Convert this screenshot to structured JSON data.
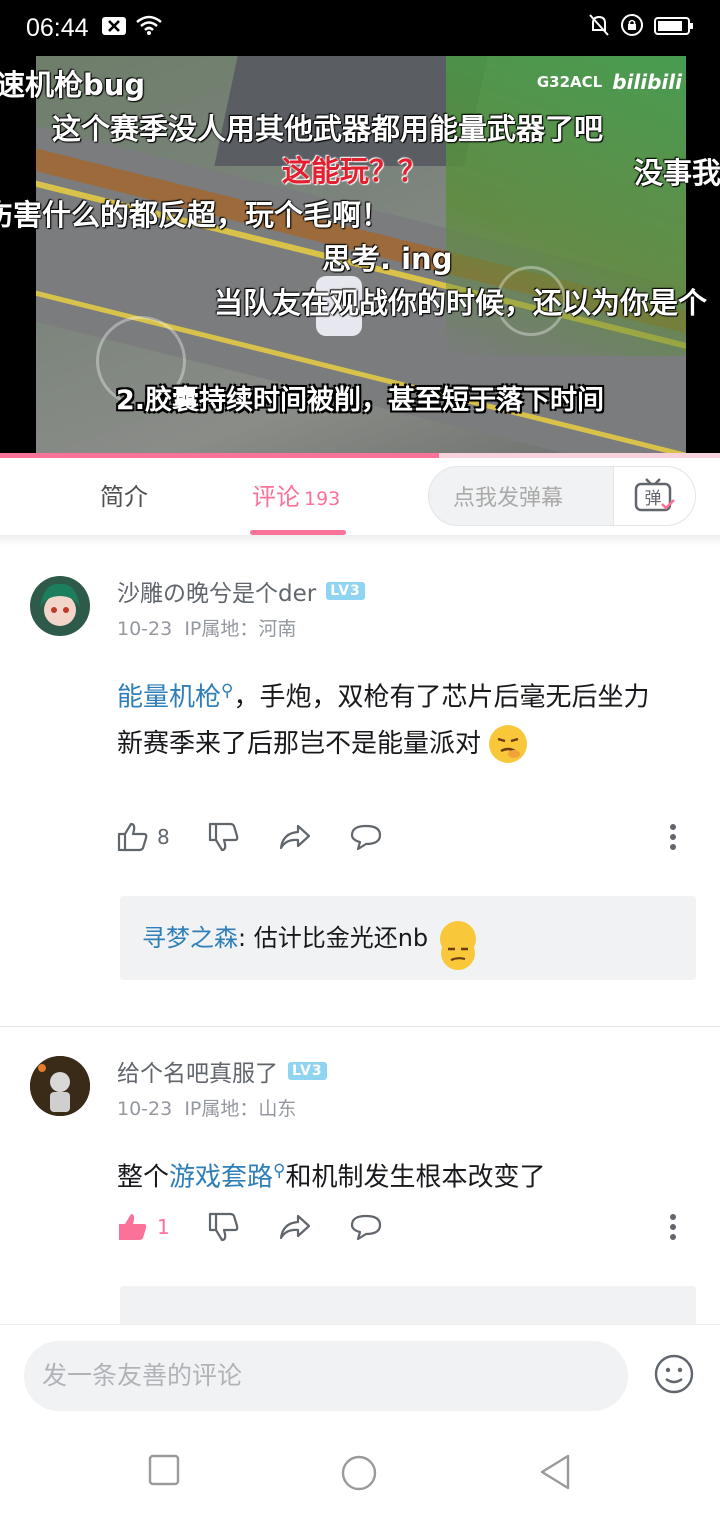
{
  "status_bar": {
    "time": "06:44"
  },
  "video": {
    "danmaku": [
      {
        "text": "速机枪bug",
        "style": "white"
      },
      {
        "text": "这个赛季没人用其他武器都用能量武器了吧",
        "style": "white"
      },
      {
        "text": "这能玩？？",
        "style": "red"
      },
      {
        "text": "没事我",
        "style": "white"
      },
      {
        "text": "伤害什么的都反超，玩个毛啊！",
        "style": "white"
      },
      {
        "text": "思考. ing",
        "style": "white"
      },
      {
        "text": "当队友在观战你的时候，还以为你是个",
        "style": "white"
      }
    ],
    "subtitle": "2.胶囊持续时间被削，甚至短于落下时间",
    "watermark_code": "G32ACL",
    "watermark_logo": "bilibili",
    "progress_percent": 61
  },
  "tabs": {
    "intro_label": "简介",
    "comments_label": "评论",
    "comments_count": "193",
    "danmu_placeholder": "点我发弹幕",
    "danmu_button": "弹"
  },
  "comments": [
    {
      "username": "沙雕の晚兮是个der",
      "level": "LV3",
      "date": "10-23",
      "ip": "IP属地：河南",
      "content_link": "能量机枪",
      "content_rest": "，手炮，双枪有了芯片后毫无后坐力",
      "content_line2": "新赛季来了后那岂不是能量派对",
      "likes": "8",
      "reply": {
        "author": "寻梦之森",
        "text": ": 估计比金光还nb"
      }
    },
    {
      "username": "给个名吧真服了",
      "level": "LV3",
      "date": "10-23",
      "ip": "IP属地：山东",
      "content_prefix": "整个",
      "content_link": "游戏套路",
      "content_rest": "和机制发生根本改变了",
      "likes": "1"
    }
  ],
  "composer": {
    "placeholder": "发一条友善的评论"
  },
  "colors": {
    "accent": "#fb7299",
    "link": "#2f7fb8",
    "level_badge": "#8fd4f0"
  }
}
